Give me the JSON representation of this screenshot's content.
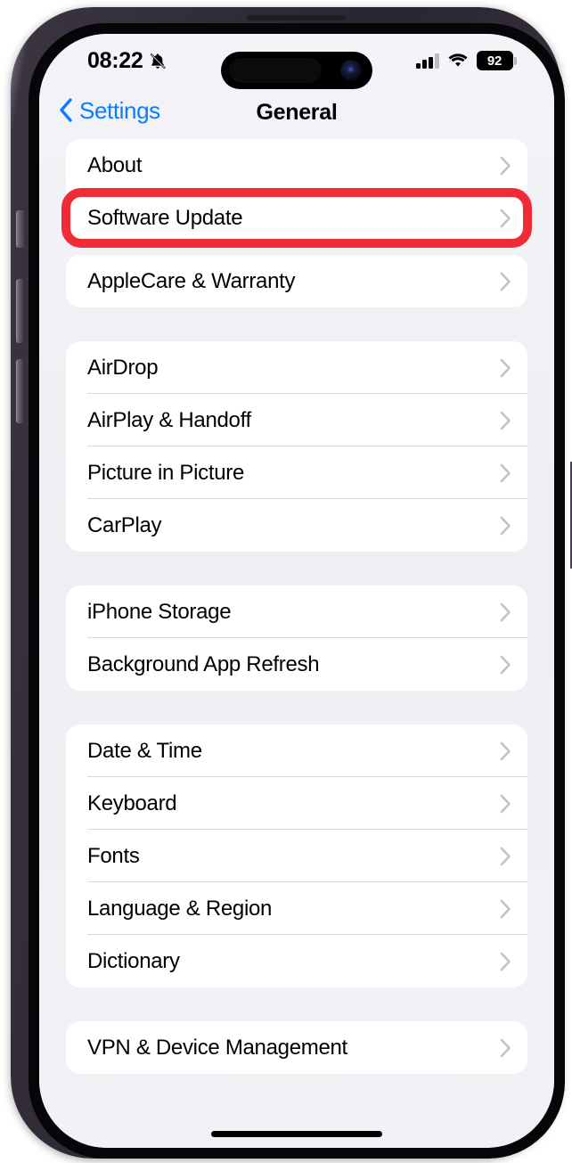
{
  "status_bar": {
    "time": "08:22",
    "bell_icon": "bell-slash-icon",
    "signal_icon": "cellular-signal-icon",
    "signal_bars_filled": 3,
    "signal_bars_total": 4,
    "wifi_icon": "wifi-icon",
    "battery_icon": "battery-icon",
    "battery_percent": "92"
  },
  "nav": {
    "back_label": "Settings",
    "back_icon": "chevron-left-icon",
    "title": "General"
  },
  "colors": {
    "accent_blue": "#0a7cff",
    "annotation_red": "#ef2b36",
    "background": "#f1f1f6",
    "card": "#ffffff",
    "separator": "#d8d8dd",
    "chevron": "#c2c2c7"
  },
  "annotation": {
    "type": "rectangle-highlight",
    "target": "Software Update",
    "color": "#ef2b36"
  },
  "groups": [
    {
      "id": "group-about",
      "gap": "small",
      "rows": [
        {
          "label": "About",
          "chevron": "chevron-right-icon"
        },
        {
          "label": "Software Update",
          "chevron": "chevron-right-icon",
          "highlighted": true
        }
      ]
    },
    {
      "id": "group-applecare",
      "gap": "large",
      "rows": [
        {
          "label": "AppleCare & Warranty",
          "chevron": "chevron-right-icon"
        }
      ]
    },
    {
      "id": "group-connectivity",
      "gap": "large",
      "rows": [
        {
          "label": "AirDrop",
          "chevron": "chevron-right-icon"
        },
        {
          "label": "AirPlay & Handoff",
          "chevron": "chevron-right-icon"
        },
        {
          "label": "Picture in Picture",
          "chevron": "chevron-right-icon"
        },
        {
          "label": "CarPlay",
          "chevron": "chevron-right-icon"
        }
      ]
    },
    {
      "id": "group-storage",
      "gap": "large",
      "rows": [
        {
          "label": "iPhone Storage",
          "chevron": "chevron-right-icon"
        },
        {
          "label": "Background App Refresh",
          "chevron": "chevron-right-icon"
        }
      ]
    },
    {
      "id": "group-localization",
      "gap": "large",
      "rows": [
        {
          "label": "Date & Time",
          "chevron": "chevron-right-icon"
        },
        {
          "label": "Keyboard",
          "chevron": "chevron-right-icon"
        },
        {
          "label": "Fonts",
          "chevron": "chevron-right-icon"
        },
        {
          "label": "Language & Region",
          "chevron": "chevron-right-icon"
        },
        {
          "label": "Dictionary",
          "chevron": "chevron-right-icon"
        }
      ]
    },
    {
      "id": "group-vpn",
      "gap": "small",
      "rows": [
        {
          "label": "VPN & Device Management",
          "chevron": "chevron-right-icon"
        }
      ]
    }
  ]
}
